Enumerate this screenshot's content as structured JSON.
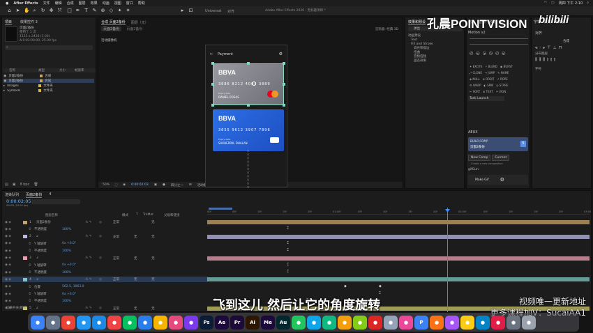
{
  "menubar": {
    "app": "After Effects",
    "items": [
      "文件",
      "编辑",
      "合成",
      "图层",
      "效果",
      "动画",
      "视图",
      "窗口",
      "帮助"
    ],
    "clock": "周四 下午 2:10"
  },
  "window_title": "Adobe After Effects 2020 - 无标题项目 *",
  "toolbar": {
    "snap_label": "Universal",
    "align_label": "对齐"
  },
  "project_panel": {
    "tab": "项目",
    "effects_tab": "效果控件 3",
    "selected_name": "页面2备份",
    "selected_info_1": "使用了 1 次",
    "selected_info_2": "1125 x 2436 (1.00)",
    "selected_info_3": "Δ 0:03:00:00, 25.00 fps",
    "columns": [
      "名称",
      "类型",
      "大小",
      "帧速率"
    ],
    "rows": [
      {
        "name": "页面2备份",
        "type": "合成",
        "color": "#c9a165",
        "selected": false
      },
      {
        "name": "页面2备份",
        "type": "合成",
        "color": "#c9a165",
        "selected": true
      },
      {
        "name": "Images",
        "type": "文件夹",
        "color": "#d9b544",
        "selected": false
      },
      {
        "name": "Symbols",
        "type": "文件夹",
        "color": "#d9b544",
        "selected": false
      }
    ],
    "bpc": "8 bpc"
  },
  "composition": {
    "tab_label": "合成 页面2备份",
    "breadcrumb": "页面2备份",
    "tab2": "页面2备份",
    "layer_tab": "图层（无）",
    "renderer": "渲染器: 经典 3D",
    "camera_label": "活动摄像机",
    "footer": {
      "zoom": "50%",
      "time": "0:00:02:03",
      "quality": "四分之一",
      "camera": "活动摄像机",
      "views": "1个视图",
      "offset": "+0.0"
    }
  },
  "phone": {
    "header": "Payment",
    "back": "←",
    "cards": [
      {
        "bank": "BBVA",
        "number": "3686  8212  4003  3889",
        "exp": "Expiry date",
        "holder": "DANIEL ROSAS",
        "variant": "gray"
      },
      {
        "bank": "BBVA",
        "number": "3655  9612  3907  7896",
        "exp": "Expiry date",
        "holder": "SUKHERPAL DHALAN",
        "variant": "blue"
      }
    ]
  },
  "effects_panel": {
    "tab": "效果和预设",
    "search_placeholder": "弹出",
    "tree": [
      "动画预设",
      "Text",
      "Fill and Stroke",
      "调光和描边",
      "扭曲",
      "音频倍频",
      "固态效果"
    ]
  },
  "right_panels": {
    "tabs": [
      "信息",
      "音频",
      "预览",
      "库",
      "字符",
      "段落",
      "跟踪器",
      "画笔"
    ],
    "motion_tab": "Motion v2",
    "align_tab": "对齐",
    "align_to": "合成",
    "distribute_label": "分布图层",
    "character_label": "字符",
    "task_label": "Task Launch",
    "aeux": {
      "label": "AEUX",
      "build_comp": "BUILD COMP",
      "build_name": "页面2备份",
      "new_comp": "New Comp",
      "current": "Current",
      "create_note": "Create a new composition",
      "gif_label": "gifGun",
      "make_gif": "Make Gif"
    }
  },
  "timeline": {
    "tabs": [
      "渲染队列",
      "页面2备份",
      "4"
    ],
    "timecode": "0:00:02:05",
    "frame_info": "00053 (25.00 fps)",
    "columns": [
      "图层名称",
      "模式",
      "T",
      "TrkMat",
      "父级和链接"
    ],
    "ruler": [
      "00f",
      "05f",
      "10f",
      "15f",
      "20f",
      "01:00f",
      "05f",
      "10f",
      "15f",
      "20f",
      "02:00f",
      "05f",
      "10f",
      "15f",
      "20f",
      "03:00"
    ],
    "rows": [
      {
        "num": "1",
        "name": "页面2备份",
        "mode": "正常",
        "parent": "无",
        "color": "#c9a165",
        "kind": "layer"
      },
      {
        "num": "",
        "name": "不透明度",
        "value": "100%",
        "kind": "prop"
      },
      {
        "num": "2",
        "name": "5",
        "mode": "正常",
        "trk": "无",
        "parent": "无",
        "color": "#b8b8e8",
        "kind": "layer"
      },
      {
        "num": "",
        "name": "Y 轴旋转",
        "value": "0x +0.0°",
        "kind": "prop"
      },
      {
        "num": "",
        "name": "不透明度",
        "value": "100%",
        "kind": "prop"
      },
      {
        "num": "3",
        "name": "3",
        "mode": "正常",
        "trk": "无",
        "parent": "无",
        "color": "#e8a0b0",
        "kind": "layer"
      },
      {
        "num": "",
        "name": "Y 轴旋转",
        "value": "0x +0.0°",
        "kind": "prop"
      },
      {
        "num": "",
        "name": "不透明度",
        "value": "100%",
        "kind": "prop"
      },
      {
        "num": "4",
        "name": "3",
        "mode": "正常",
        "trk": "无",
        "parent": "无",
        "color": "#7fc7c2",
        "kind": "layer"
      },
      {
        "num": "",
        "name": "位置",
        "value": "562.5, 1063.0",
        "kind": "prop"
      },
      {
        "num": "",
        "name": "Y 轴旋转",
        "value": "0x +0.0°",
        "kind": "prop"
      },
      {
        "num": "",
        "name": "不透明度",
        "value": "100%",
        "kind": "prop"
      },
      {
        "num": "5",
        "name": "2",
        "mode": "正常",
        "trk": "无",
        "parent": "无",
        "color": "#cdc76a",
        "kind": "layer"
      }
    ],
    "footer": "切换开关/模式"
  },
  "watermark": {
    "logo_text": "孔晨POINTVISION",
    "bili": "bilibili",
    "line1": "视频唯一更新地址",
    "line2": "更多课程加V：SucaiAA1"
  },
  "subtitle": "飞到这儿 然后让它的角度旋转",
  "dock": [
    {
      "label": "",
      "color": "#3b82f6"
    },
    {
      "label": "",
      "color": "#64748b"
    },
    {
      "label": "",
      "color": "#ea4335"
    },
    {
      "label": "",
      "color": "#2196f3"
    },
    {
      "label": "",
      "color": "#1e88e5"
    },
    {
      "label": "",
      "color": "#ef4444"
    },
    {
      "label": "",
      "color": "#07c160"
    },
    {
      "label": "",
      "color": "#2b7de9"
    },
    {
      "label": "",
      "color": "#f7b500"
    },
    {
      "label": "",
      "color": "#e54a7c"
    },
    {
      "label": "",
      "color": "#7c3aed"
    },
    {
      "label": "Ps",
      "color": "#0b1d36"
    },
    {
      "label": "Ae",
      "color": "#1c0a3d"
    },
    {
      "label": "Pr",
      "color": "#1d0a38"
    },
    {
      "label": "Ai",
      "color": "#2e1700"
    },
    {
      "label": "Me",
      "color": "#1c0a3d"
    },
    {
      "label": "Au",
      "color": "#00262e"
    },
    {
      "label": "",
      "color": "#22c55e"
    },
    {
      "label": "",
      "color": "#0ea5e9"
    },
    {
      "label": "",
      "color": "#10b981"
    },
    {
      "label": "",
      "color": "#f59e0b"
    },
    {
      "label": "",
      "color": "#84cc16"
    },
    {
      "label": "",
      "color": "#dc2626"
    },
    {
      "label": "",
      "color": "#94a3b8"
    },
    {
      "label": "",
      "color": "#ec4899"
    },
    {
      "label": "P",
      "color": "#3b82f6"
    },
    {
      "label": "",
      "color": "#f97316"
    },
    {
      "label": "",
      "color": "#a855f7"
    },
    {
      "label": "",
      "color": "#facc15"
    },
    {
      "label": "",
      "color": "#0284c7"
    },
    {
      "label": "",
      "color": "#e11d48"
    },
    {
      "label": "",
      "color": "#6b7280"
    },
    {
      "label": "",
      "color": "#9ca3af"
    }
  ]
}
